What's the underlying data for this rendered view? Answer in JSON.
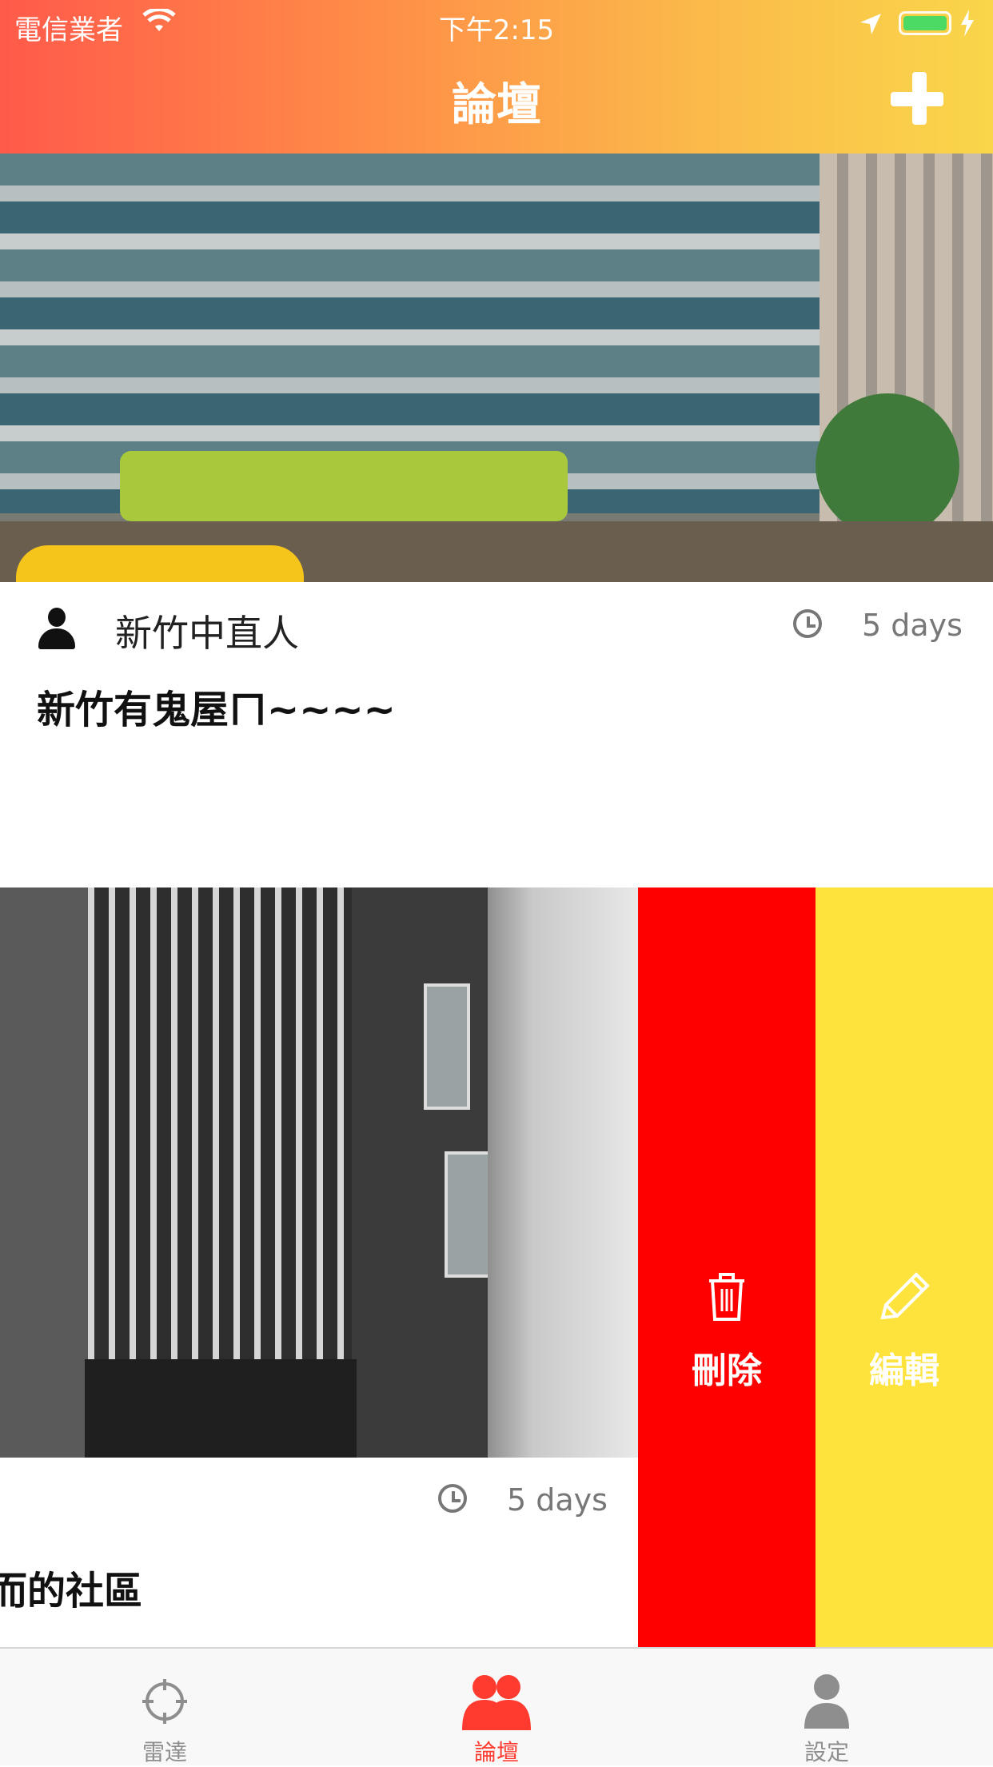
{
  "status_bar": {
    "carrier": "電信業者",
    "time": "下午2:15"
  },
  "header": {
    "title": "論壇",
    "add_icon": "plus-icon"
  },
  "posts": [
    {
      "author": "新竹中直人",
      "time_ago": "5 days",
      "title": "新竹有鬼屋ㄇ~~~~"
    },
    {
      "time_ago": "5 days",
      "title_visible": "而的社區"
    }
  ],
  "swipe_actions": {
    "delete_label": "刪除",
    "edit_label": "編輯",
    "delete_color": "#ff0000",
    "edit_color": "#fde33b"
  },
  "tabbar": {
    "tabs": [
      {
        "label": "雷達",
        "icon": "crosshair-icon",
        "active": false
      },
      {
        "label": "論壇",
        "icon": "people-icon",
        "active": true
      },
      {
        "label": "設定",
        "icon": "person-icon",
        "active": false
      }
    ],
    "active_color": "#ff3b30"
  }
}
